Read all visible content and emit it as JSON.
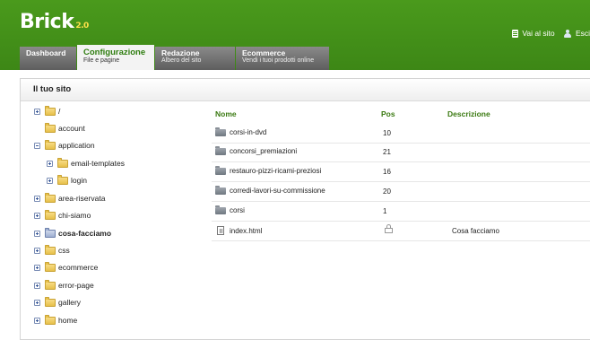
{
  "colors": {
    "header_green": "#4a9a1c",
    "accent_text_green": "#3b7a12",
    "tab_gray": "#6e6e6e"
  },
  "header": {
    "logo": "Brick",
    "logo_version": "2.0",
    "links": [
      {
        "label": "Vai al sito",
        "icon": "document-icon"
      },
      {
        "label": "Esci",
        "icon": "user-icon"
      }
    ]
  },
  "tabs": [
    {
      "title": "Dashboard",
      "subtitle": ""
    },
    {
      "title": "Configurazione",
      "subtitle": "File e pagine",
      "active": true
    },
    {
      "title": "Redazione",
      "subtitle": "Albero del sito"
    },
    {
      "title": "Ecommerce",
      "subtitle": "Vendi i tuoi prodotti online"
    }
  ],
  "left_panel": {
    "title": "Il tuo sito",
    "tree": [
      {
        "label": "/",
        "expander": "plus",
        "icon": "folder"
      },
      {
        "label": "account",
        "expander": "none",
        "icon": "folder"
      },
      {
        "label": "application",
        "expander": "minus",
        "icon": "folder"
      },
      {
        "label": "email-templates",
        "expander": "plus",
        "icon": "folder"
      },
      {
        "label": "login",
        "expander": "plus",
        "icon": "folder"
      },
      {
        "label": "area-riservata",
        "expander": "plus",
        "icon": "folder"
      },
      {
        "label": "chi-siamo",
        "expander": "plus",
        "icon": "folder"
      },
      {
        "label": "cosa-facciamo",
        "expander": "plus",
        "icon": "page-folder",
        "bold": true
      },
      {
        "label": "css",
        "expander": "plus",
        "icon": "folder"
      },
      {
        "label": "ecommerce",
        "expander": "plus",
        "icon": "folder"
      },
      {
        "label": "error-page",
        "expander": "plus",
        "icon": "folder"
      },
      {
        "label": "gallery",
        "expander": "plus",
        "icon": "folder"
      },
      {
        "label": "home",
        "expander": "plus",
        "icon": "folder"
      }
    ]
  },
  "table": {
    "headers": {
      "name": "Nome",
      "pos": "Pos",
      "desc": "Descrizione"
    },
    "rows": [
      {
        "name": "corsi-in-dvd",
        "pos": "10",
        "desc": "",
        "icon": "folder-icon"
      },
      {
        "name": "concorsi_premiazioni",
        "pos": "21",
        "desc": "",
        "icon": "folder-icon"
      },
      {
        "name": "restauro-pizzi-ricami-preziosi",
        "pos": "16",
        "desc": "",
        "icon": "folder-icon"
      },
      {
        "name": "corredi-lavori-su-commissione",
        "pos": "20",
        "desc": "",
        "icon": "folder-icon"
      },
      {
        "name": "corsi",
        "pos": "1",
        "desc": "",
        "icon": "folder-icon"
      },
      {
        "name": "index.html",
        "pos": "",
        "desc": "Cosa facciamo",
        "icon": "page-icon",
        "locked": true
      }
    ]
  }
}
